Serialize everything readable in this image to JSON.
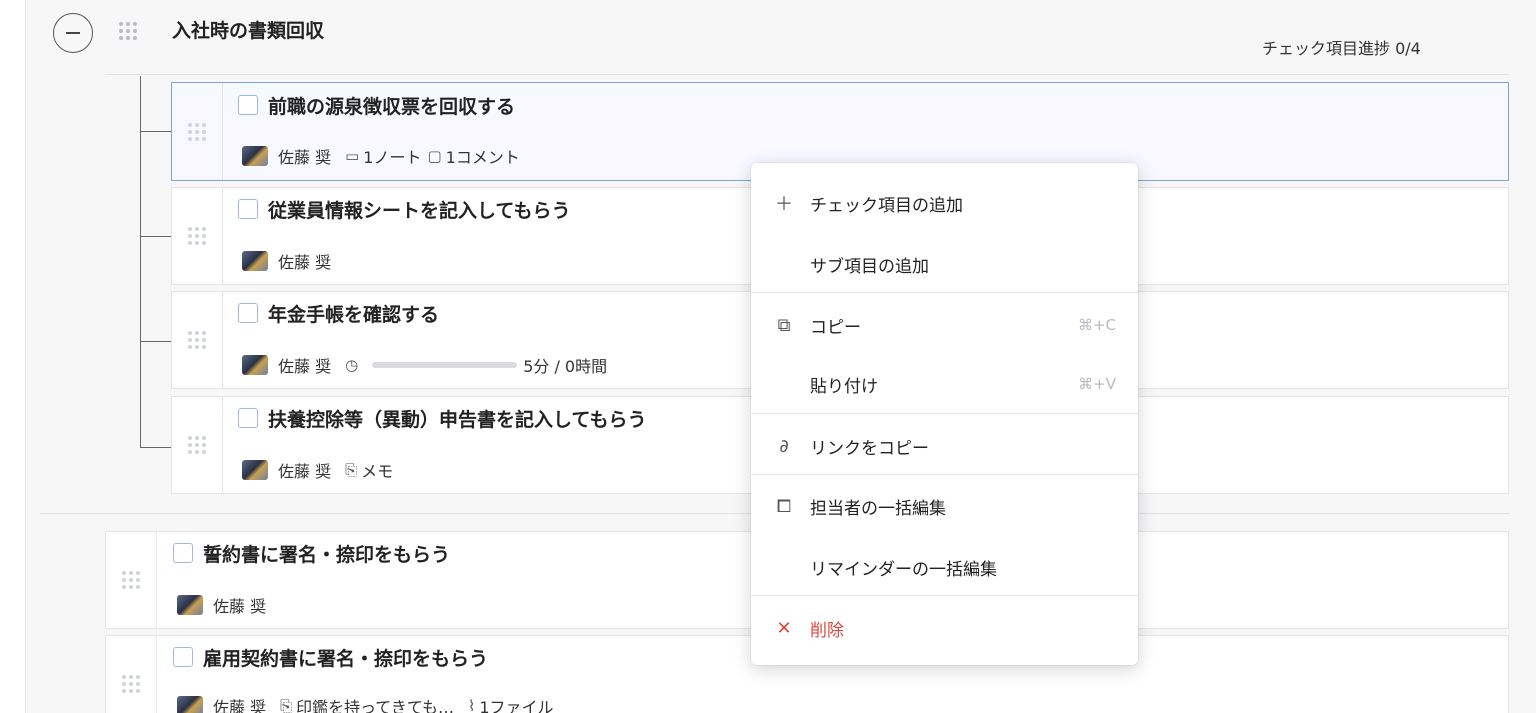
{
  "group": {
    "title": "入社時の書類回収",
    "progress": "チェック項目進捗 0/4"
  },
  "items": [
    {
      "title": "前職の源泉徴収票を回収する",
      "assignee": "佐藤 奨",
      "notes": "1ノート",
      "comments": "1コメント"
    },
    {
      "title": "従業員情報シートを記入してもらう",
      "assignee": "佐藤 奨"
    },
    {
      "title": "年金手帳を確認する",
      "assignee": "佐藤 奨",
      "time": "5分 / 0時間"
    },
    {
      "title": "扶養控除等（異動）申告書を記入してもらう",
      "assignee": "佐藤 奨",
      "memo": "メモ"
    }
  ],
  "items_outer": [
    {
      "title": "誓約書に署名・捺印をもらう",
      "assignee": "佐藤 奨"
    },
    {
      "title": "雇用契約書に署名・捺印をもらう",
      "assignee": "佐藤 奨",
      "memo": "印鑑を持ってきても…",
      "files": "1ファイル"
    }
  ],
  "menu": {
    "add_check_item": "チェック項目の追加",
    "add_sub_item": "サブ項目の追加",
    "copy": "コピー",
    "copy_shortcut": "⌘+C",
    "paste": "貼り付け",
    "paste_shortcut": "⌘+V",
    "copy_link": "リンクをコピー",
    "bulk_edit_assignee": "担当者の一括編集",
    "bulk_edit_reminder": "リマインダーの一括編集",
    "delete": "削除"
  },
  "icons": {
    "collapse": "minus-circle-icon",
    "drag": "drag-handle-icon",
    "add": "plus-icon",
    "copy": "copy-icon",
    "link": "link-icon",
    "bulk": "bulk-edit-icon",
    "delete": "close-icon",
    "note": "note-icon",
    "comment": "comment-icon",
    "timer": "timer-icon",
    "memo": "memo-icon",
    "attachment": "attachment-icon"
  },
  "colors": {
    "accent": "#7ea4e0",
    "danger": "#e0463b"
  }
}
